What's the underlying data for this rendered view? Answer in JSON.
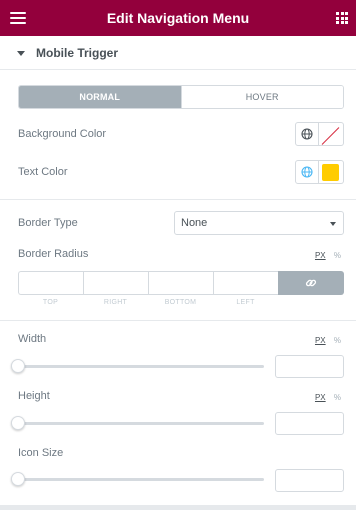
{
  "header": {
    "title": "Edit Navigation Menu",
    "menu_icon": "hamburger-icon",
    "apps_icon": "grid-icon"
  },
  "section": {
    "title": "Mobile Trigger"
  },
  "tabs": [
    {
      "label": "NORMAL",
      "active": true
    },
    {
      "label": "HOVER",
      "active": false
    }
  ],
  "colors": {
    "background": {
      "label": "Background Color",
      "value": "none"
    },
    "text": {
      "label": "Text Color",
      "value": "#ffcc00"
    }
  },
  "border_type": {
    "label": "Border Type",
    "value": "None"
  },
  "border_radius": {
    "label": "Border Radius",
    "units": [
      "PX",
      "%"
    ],
    "sides": [
      "TOP",
      "RIGHT",
      "BOTTOM",
      "LEFT"
    ],
    "link_icon": "link-icon"
  },
  "width": {
    "label": "Width",
    "units": [
      "PX",
      "%"
    ],
    "value": ""
  },
  "height": {
    "label": "Height",
    "units": [
      "PX",
      "%"
    ],
    "value": ""
  },
  "icon_size": {
    "label": "Icon Size",
    "value": ""
  },
  "theme": {
    "header_bg": "#93003c",
    "tab_active_bg": "#a4afb7",
    "accent_blue": "#4ab7f4"
  }
}
